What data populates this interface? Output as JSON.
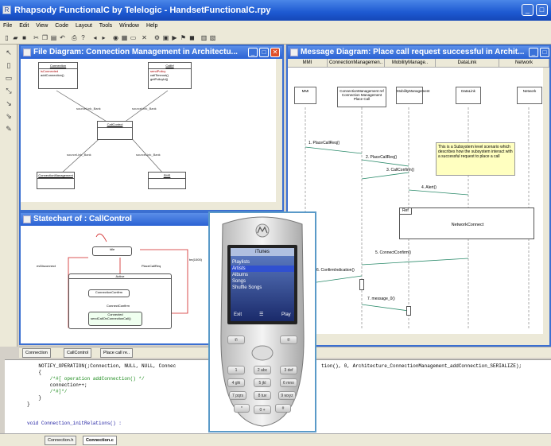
{
  "app": {
    "title": "Rhapsody FunctionalC by Telelogic - HandsetFunctionalC.rpy",
    "window_controls": [
      "_",
      "□"
    ]
  },
  "menu": [
    "File",
    "Edit",
    "View",
    "Code",
    "Layout",
    "Tools",
    "Window",
    "Help"
  ],
  "file_diagram": {
    "title": "File Diagram: Connection Management in Architectu...",
    "boxes": [
      {
        "name": "Connection",
        "attr": "isConnected",
        "ops": [
          "addConnection()"
        ]
      },
      {
        "name": "Callbf",
        "attr": "sendPolicy",
        "ops": [
          "callTimeout()",
          "getPolicyId()"
        ]
      },
      {
        "name": "CallControl",
        "attr": "",
        "ops": []
      },
      {
        "name": "ConnectionManagement",
        "attr": "",
        "ops": []
      },
      {
        "name": "SMS",
        "attr": "",
        "ops": []
      }
    ],
    "links": [
      "sourceLink_Bank",
      "sourceLink_Bank",
      "sourceLink_Bank",
      "sourceLink_Bank"
    ]
  },
  "statechart": {
    "title": "Statechart of : CallControl",
    "states": [
      "Idle",
      "Active",
      "ConnectionConfirm",
      "Connected"
    ],
    "labels": [
      "PlaceCallReq",
      "ConnectConfirm",
      "evDisconnect",
      "tm(1000)",
      "ConnectionConfirm",
      "sendCallOnConnectionCall()"
    ]
  },
  "sequence": {
    "title": "Message Diagram: Place call request successful in Archit...",
    "columns": [
      "MMI",
      "ConnectionManagemen..",
      "MobilityManage..",
      "DataLink",
      "Network"
    ],
    "lifelines": [
      "MMI",
      "ConnectionManagement ref Connection Management Place Call",
      "MobilityManagement",
      "DataLink",
      "Network"
    ],
    "messages": [
      "1. PlaceCallReq()",
      "2. PlaceCallReq()",
      "3. CallConfirm()",
      "4. Alert()",
      "5. ConnectConfirm()",
      "6. ConfirmIndication()",
      "7. message_0()"
    ],
    "note": "This is a Subsystem level scenario which describes how the subsystem interact with a successful request to place a call",
    "ref_label": "Ref",
    "ref_text": "NetworkConnect"
  },
  "tabs": [
    "Connection",
    "CallControl",
    "Place call re.."
  ],
  "code": {
    "lines": [
      "    NOTIFY_OPERATION(;Connection, NULL, NULL, Connec",
      "    {",
      "        /*#[ operation addConnection() */",
      "        connection++;",
      "        /*#]*/",
      "    }",
      "}",
      "",
      "void Connection_initRelations() :"
    ],
    "tail": "tion(), 0, Architecture_ConnectionManagement_addConnection_SERIALIZE);",
    "tabs": [
      "Connection.h",
      "Connection.c"
    ]
  },
  "phone": {
    "brand": "MOTOROLA",
    "screen_title": "iTunes",
    "menu_items": [
      "Playlists",
      "Artists",
      "Albums",
      "Songs",
      "Shuffle Songs"
    ],
    "selected_index": 1,
    "softkeys": [
      "Exit",
      "Play"
    ],
    "keys": [
      "1",
      "2 abc",
      "3 def",
      "4 ghi",
      "5 jkl",
      "6 mno",
      "7 pqrs",
      "8 tuv",
      "9 wxyz",
      "*",
      "0 +",
      "#"
    ]
  },
  "colors": {
    "title_blue": "#1d59d1",
    "mdi_border": "#3b6fd1",
    "note_yellow": "#ffffc0",
    "phone_frame": "#5a9ac8",
    "transition_red": "#d02020"
  }
}
